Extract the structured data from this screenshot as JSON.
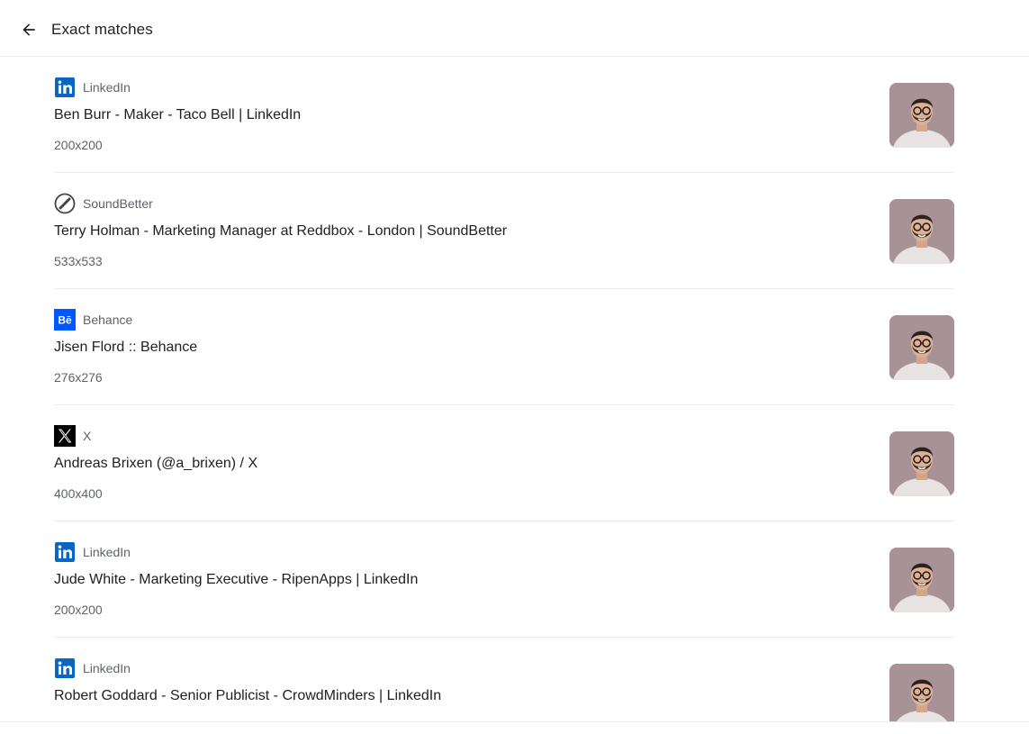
{
  "header": {
    "title": "Exact matches",
    "back_icon": "arrow-back-icon"
  },
  "colors": {
    "linkedin": "#0a66c2",
    "behance": "#0057ff",
    "x": "#000000",
    "divider": "#e8eaed",
    "photo_bg": "#a79397"
  },
  "results": [
    {
      "source": "LinkedIn",
      "icon": "linkedin-icon",
      "title": "Ben Burr - Maker - Taco Bell | LinkedIn",
      "dims": "200x200"
    },
    {
      "source": "SoundBetter",
      "icon": "soundbetter-icon",
      "title": "Terry Holman - Marketing Manager at Reddbox - London | SoundBetter",
      "dims": "533x533"
    },
    {
      "source": "Behance",
      "icon": "behance-icon",
      "title": "Jisen Flord :: Behance",
      "dims": "276x276"
    },
    {
      "source": "X",
      "icon": "x-icon",
      "title": "Andreas Brixen (@a_brixen) / X",
      "dims": "400x400"
    },
    {
      "source": "LinkedIn",
      "icon": "linkedin-icon",
      "title": "Jude White - Marketing Executive - RipenApps | LinkedIn",
      "dims": "200x200"
    },
    {
      "source": "LinkedIn",
      "icon": "linkedin-icon",
      "title": "Robert Goddard - Senior Publicist - CrowdMinders | LinkedIn",
      "dims": ""
    }
  ]
}
